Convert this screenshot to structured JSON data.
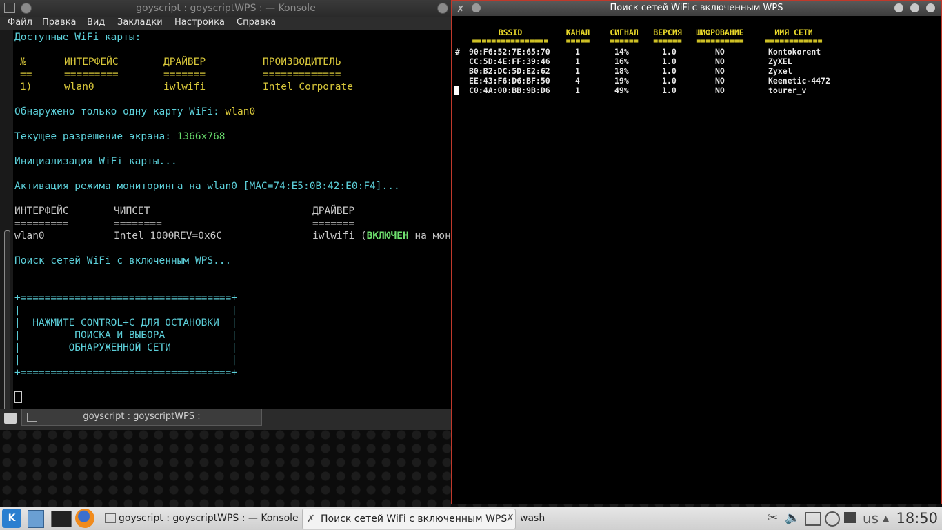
{
  "konsole": {
    "title": "goyscript : goyscriptWPS : — Konsole",
    "menu": [
      "Файл",
      "Правка",
      "Вид",
      "Закладки",
      "Настройка",
      "Справка"
    ],
    "tab_label": "goyscript : goyscriptWPS :",
    "terminal": {
      "available_cards": "Доступные WiFi карты:",
      "card_headers": [
        "№",
        "ИНТЕРФЕЙС",
        "ДРАЙВЕР",
        "ПРОИЗВОДИТЕЛЬ"
      ],
      "card_underlines": [
        "==",
        "=========",
        "=======",
        "============="
      ],
      "card_row": [
        "1)",
        "wlan0",
        "iwlwifi",
        "Intel Corporate"
      ],
      "found_prefix": "Обнаружено только одну карту WiFi: ",
      "found_value": "wlan0",
      "resolution_prefix": "Текущее разрешение экрана: ",
      "resolution_value": "1366x768",
      "init": "Инициализация WiFi карты...",
      "monitor": "Активация режима мониторинга на wlan0 [MAC=74:E5:0B:42:E0:F4]...",
      "chip_headers": [
        "ИНТЕРФЕЙС",
        "ЧИПСЕТ",
        "ДРАЙВЕР"
      ],
      "chip_underlines": [
        "=========",
        "========",
        "======="
      ],
      "chip_row": [
        "wlan0",
        "Intel 1000REV=0x6C",
        "iwlwifi ("
      ],
      "chip_enabled": "ВКЛЮЧЕН",
      "chip_suffix": " на мон",
      "searching": "Поиск сетей WiFi с включенным WPS...",
      "box_border": "+===================================+",
      "box_lines": [
        "|                                   |",
        "|  НАЖМИТЕ CONTROL+C ДЛЯ ОСТАНОВКИ  |",
        "|         ПОИСКА И ВЫБОРА           |",
        "|        ОБНАРУЖЕННОЙ СЕТИ          |",
        "|                                   |"
      ]
    }
  },
  "wash": {
    "title": "Поиск сетей WiFi с включенным WPS",
    "headers": [
      "BSSID",
      "КАНАЛ",
      "СИГНАЛ",
      "ВЕРСИЯ",
      "ШИФРОВАНИЕ",
      "ИМЯ СЕТИ"
    ],
    "underlines": [
      "================",
      "=====",
      "======",
      "======",
      "==========",
      "============"
    ],
    "row_marker": "#",
    "rows": [
      [
        "90:F6:52:7E:65:70",
        "1",
        "14%",
        "1.0",
        "NO",
        "Kontokorent"
      ],
      [
        "CC:5D:4E:FF:39:46",
        "1",
        "16%",
        "1.0",
        "NO",
        "ZyXEL"
      ],
      [
        "B0:B2:DC:5D:E2:62",
        "1",
        "18%",
        "1.0",
        "NO",
        "Zyxel"
      ],
      [
        "EE:43:F6:D6:BF:50",
        "4",
        "19%",
        "1.0",
        "NO",
        "Keenetic-4472"
      ],
      [
        "C0:4A:00:BB:9B:D6",
        "1",
        "49%",
        "1.0",
        "NO",
        "tourer_v"
      ]
    ]
  },
  "taskbar": {
    "tasks": [
      "goyscript : goyscriptWPS : — Konsole",
      "Поиск сетей WiFi с включенным WPS",
      "wash"
    ],
    "keyboard_layout": "us",
    "clock": "18:50"
  }
}
